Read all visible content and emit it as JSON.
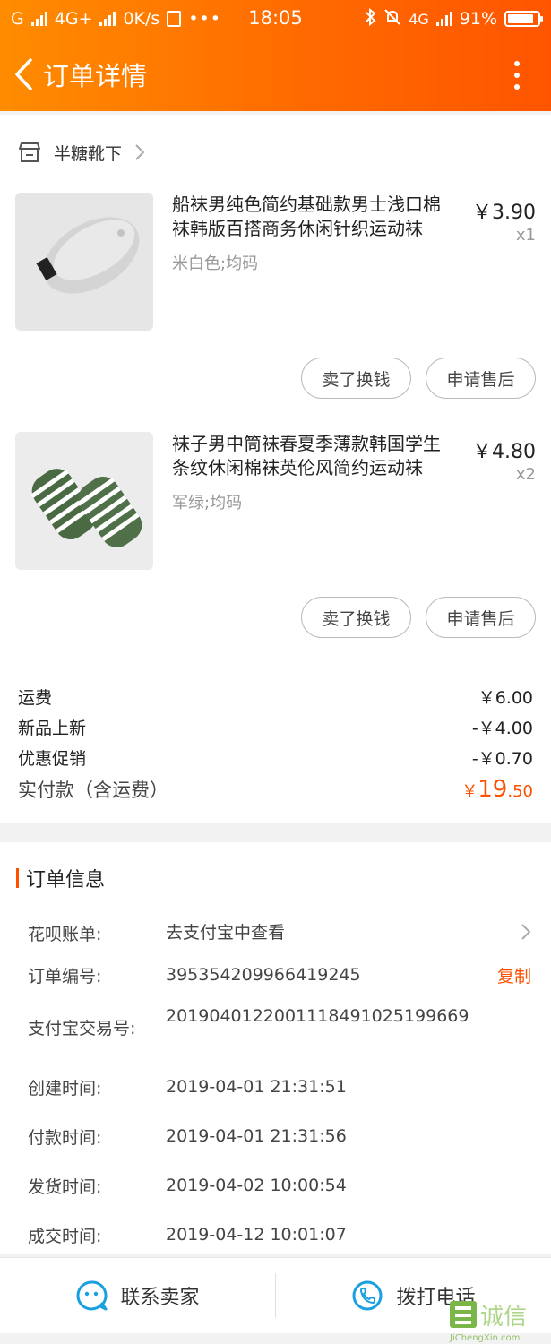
{
  "status_bar": {
    "carrier": "G",
    "network": "4G+",
    "speed": "0K/s",
    "time": "18:05",
    "network2": "4G",
    "battery": "91%"
  },
  "nav": {
    "title": "订单详情"
  },
  "shop": {
    "name": "半糖靴下"
  },
  "items": [
    {
      "title": "船袜男纯色简约基础款男士浅口棉袜韩版百搭商务休闲针织运动袜",
      "sku": "米白色;均码",
      "price": "￥3.90",
      "qty": "x1",
      "btn_resell": "卖了换钱",
      "btn_aftersale": "申请售后"
    },
    {
      "title": "袜子男中筒袜春夏季薄款韩国学生条纹休闲棉袜英伦风简约运动袜",
      "sku": "军绿;均码",
      "price": "￥4.80",
      "qty": "x2",
      "btn_resell": "卖了换钱",
      "btn_aftersale": "申请售后"
    }
  ],
  "fees": [
    {
      "label": "运费",
      "value": "￥6.00"
    },
    {
      "label": "新品上新",
      "value": "-￥4.00"
    },
    {
      "label": "优惠促销",
      "value": "-￥0.70"
    }
  ],
  "total": {
    "label": "实付款（含运费）",
    "symbol": "￥",
    "int": "19",
    "dec": ".50"
  },
  "order_info": {
    "heading": "订单信息",
    "rows": [
      {
        "label": "花呗账单:",
        "value": "去支付宝中查看"
      },
      {
        "label": "订单编号:",
        "value": "395354209966419245",
        "action": "复制"
      },
      {
        "label": "支付宝交易号:",
        "value": "2019040122001118491025199669"
      },
      {
        "label": "创建时间:",
        "value": "2019-04-01 21:31:51"
      },
      {
        "label": "付款时间:",
        "value": "2019-04-01 21:31:56"
      },
      {
        "label": "发货时间:",
        "value": "2019-04-02 10:00:54"
      },
      {
        "label": "成交时间:",
        "value": "2019-04-12 10:01:07"
      }
    ]
  },
  "bottom_bar": {
    "contact_seller": "联系卖家",
    "call_phone": "拨打电话"
  },
  "watermark": {
    "text": "诚信",
    "domain": "JiChengXin.com"
  },
  "colors": {
    "accent": "#ff5000",
    "header_start": "#ff8c00",
    "header_end": "#ff5500",
    "icon_blue": "#1aa0e0"
  }
}
